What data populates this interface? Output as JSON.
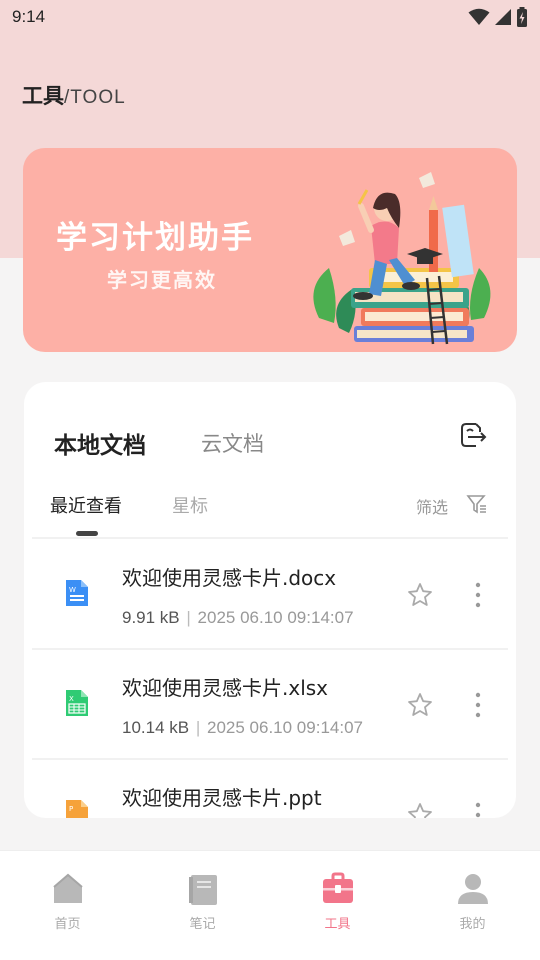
{
  "status_bar": {
    "time": "9:14",
    "icons": [
      "wifi-icon",
      "signal-icon",
      "battery-icon"
    ]
  },
  "header": {
    "title": "工具",
    "subtitle": "/TOOL"
  },
  "banner": {
    "title": "学习计划助手",
    "subtitle": "学习更高效",
    "background_color": "#fdb0a6"
  },
  "doc_tabs": [
    {
      "label": "本地文档",
      "active": true
    },
    {
      "label": "云文档",
      "active": false
    }
  ],
  "sub_tabs": [
    {
      "label": "最近查看",
      "active": true
    },
    {
      "label": "星标",
      "active": false
    }
  ],
  "filter": {
    "label": "筛选"
  },
  "files": [
    {
      "name": "欢迎使用灵感卡片.docx",
      "size": "9.91 kB",
      "date": "2025 06.10 09:14:07",
      "icon": "word-file-icon",
      "color": "#3b8ff5"
    },
    {
      "name": "欢迎使用灵感卡片.xlsx",
      "size": "10.14 kB",
      "date": "2025 06.10 09:14:07",
      "icon": "excel-file-icon",
      "color": "#2fcb74"
    },
    {
      "name": "欢迎使用灵感卡片.ppt",
      "size": "",
      "date": "",
      "icon": "ppt-file-icon",
      "color": "#f6a23a"
    }
  ],
  "meta_separator": "|",
  "bottom_nav": [
    {
      "label": "首页",
      "icon": "home-icon",
      "active": false
    },
    {
      "label": "笔记",
      "icon": "notebook-icon",
      "active": false
    },
    {
      "label": "工具",
      "icon": "toolbox-icon",
      "active": true
    },
    {
      "label": "我的",
      "icon": "user-icon",
      "active": false
    }
  ],
  "colors": {
    "accent": "#f2758a",
    "header_bg": "#f4d8d7"
  }
}
